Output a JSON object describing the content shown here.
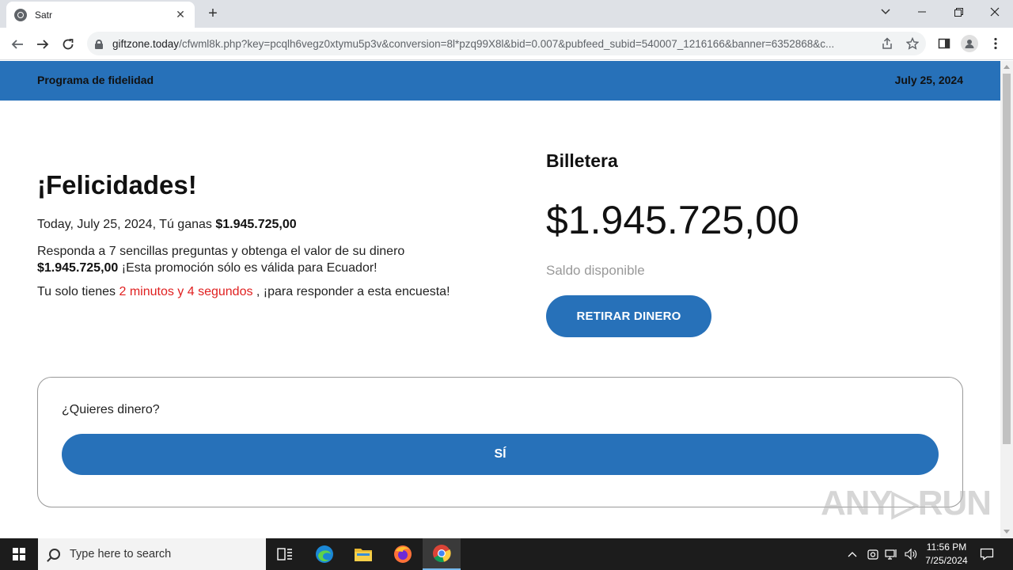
{
  "browser": {
    "tab_title": "Satr",
    "tab_close": "✕",
    "new_tab": "+",
    "url_host": "giftzone.today",
    "url_path": "/cfwml8k.php?key=pcqlh6vegz0xtymu5p3v&conversion=8l*pzq99X8l&bid=0.007&pubfeed_subid=540007_1216166&banner=6352868&c...",
    "icons": [
      "back-arrow-icon",
      "forward-arrow-icon",
      "reload-icon",
      "lock-icon",
      "share-icon",
      "star-icon",
      "side-panel-icon",
      "profile-icon",
      "menu-dots-icon"
    ]
  },
  "header": {
    "brand": "Programa de fidelidad",
    "date": "July 25, 2024",
    "color": "#2771b9"
  },
  "left": {
    "headline": "¡Felicidades!",
    "line1_prefix": "Today, July 25, 2024, Tú ganas ",
    "line1_amount": "$1.945.725,00",
    "line2_text": "Responda a 7 sencillas preguntas y obtenga el valor de su dinero",
    "line2_amount": "$1.945.725,00",
    "line2_suffix": " ¡Esta promoción sólo es válida para Ecuador!",
    "line3_prefix": "Tu solo tienes ",
    "line3_time": "2 minutos y 4 segundos",
    "line3_suffix": " , ¡para responder a esta encuesta!"
  },
  "wallet": {
    "title": "Billetera",
    "amount": "$1.945.725,00",
    "label": "Saldo disponible",
    "button": "RETIRAR DINERO"
  },
  "question": {
    "text": "¿Quieres dinero?",
    "yes_button": "SÍ"
  },
  "watermark": "ANY▷RUN",
  "taskbar": {
    "search_placeholder": "Type here to search",
    "time": "11:56 PM",
    "date": "7/25/2024"
  }
}
